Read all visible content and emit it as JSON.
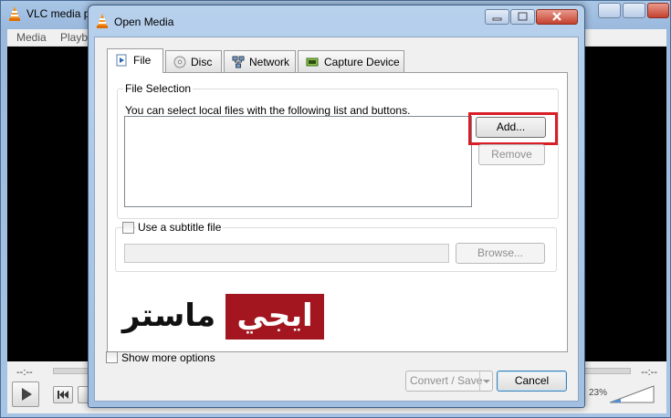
{
  "background_window": {
    "title": "VLC media p",
    "menu": [
      "Media",
      "Playb"
    ],
    "time_left": "--:--",
    "time_right": "--:--",
    "volume_percent": "23%"
  },
  "dialog": {
    "title": "Open Media",
    "tabs": [
      {
        "label": "File",
        "icon": "file-icon",
        "active": true
      },
      {
        "label": "Disc",
        "icon": "disc-icon",
        "active": false
      },
      {
        "label": "Network",
        "icon": "network-icon",
        "active": false
      },
      {
        "label": "Capture Device",
        "icon": "capture-device-icon",
        "active": false
      }
    ],
    "file_selection": {
      "group_label": "File Selection",
      "description": "You can select local files with the following list and buttons.",
      "add_label": "Add...",
      "remove_label": "Remove"
    },
    "subtitle": {
      "checkbox_label": "Use a subtitle file",
      "checked": false,
      "browse_label": "Browse..."
    },
    "watermark": {
      "white_text": "ايجي",
      "black_text": "ماستر"
    },
    "show_more_options_label": "Show more options",
    "convert_save_label": "Convert / Save",
    "cancel_label": "Cancel"
  },
  "colors": {
    "highlight_border": "#d81e27",
    "logo_red": "#a3161f",
    "titlebar_blue": "#a9c6e6"
  }
}
